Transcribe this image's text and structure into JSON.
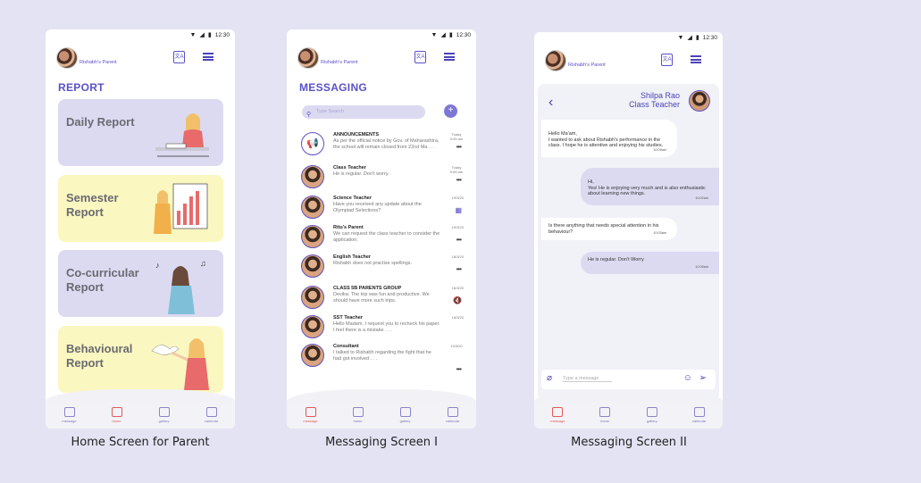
{
  "screens": {
    "home": {
      "caption": "Home Screen for Parent",
      "status": "12:30",
      "parent_label": "Rishabh's Parent",
      "title": "REPORT",
      "cards": [
        {
          "label": "Daily Report",
          "color": "#dcdaf1"
        },
        {
          "label": "Semester Report",
          "color": "#fbf7c0"
        },
        {
          "label": "Co-curricular Report",
          "color": "#dcdaf1"
        },
        {
          "label": "Behavioural Report",
          "color": "#fbf7c0"
        }
      ]
    },
    "messaging1": {
      "caption": "Messaging Screen I",
      "status": "12:30",
      "parent_label": "Rishabh's Parent",
      "title": "MESSAGING",
      "search_placeholder": "Type Search",
      "add_label": "+",
      "messages": [
        {
          "title": "ANNOUNCEMENTS",
          "text": "As per the official notice by Gov. of Maharashtra, the school will remain closed  from 22nd Ma . . .",
          "date": "Today 9:05 am",
          "icon": "megaphone-icon"
        },
        {
          "title": "Class Teacher",
          "text": "He is regular. Don't worry.",
          "date": "Today 9:05 am",
          "icon": "avatar"
        },
        {
          "title": "Science Teacher",
          "text": "Have you received any update about the Olympiad Selections?",
          "date": "19/3/20",
          "icon": "avatar"
        },
        {
          "title": "Ritu's Parent",
          "text": "We can request the class teacher to consider the application.",
          "date": "19/3/20",
          "icon": "avatar"
        },
        {
          "title": "English Teacher",
          "text": "Rishabh does not practise spellings.",
          "date": "18/3/20",
          "icon": "avatar"
        },
        {
          "title": "CLASS 5B PARENTS GROUP",
          "text": "Devika: The trip was fun and productive. We should have more such trips.",
          "date": "16/3/20",
          "icon": "avatar"
        },
        {
          "title": "SST Teacher",
          "text": "Hello Madam, I request you to recheck his paper. I feel there is a mistake . . .",
          "date": "15/3/20",
          "icon": "avatar"
        },
        {
          "title": "Consultant",
          "text": "I talked to Rishabh regarding the fight that he had got involved . . .",
          "date": "13/3/20",
          "icon": "avatar"
        }
      ]
    },
    "messaging2": {
      "caption": "Messaging Screen II",
      "status": "12:30",
      "parent_label": "Rishabh's Parent",
      "contact_name": "Shilpa Rao",
      "contact_role": "Class Teacher",
      "composer_placeholder": "Type a message",
      "chat": [
        {
          "dir": "in",
          "text": "Hello Ma'am,\nI wanted to ask about Rishabh's performance in the class. I hope he is attentive and enjoying his studies.",
          "time": "10:09am"
        },
        {
          "dir": "out",
          "text": "Hi,\nYes! He is enjoying very much and is also enthusiastic about learning new things.",
          "time": "10:02am"
        },
        {
          "dir": "in",
          "text": "Is there anything that needs special attention in his behaviour?",
          "time": "10:03am"
        },
        {
          "dir": "out",
          "text": "He is regular. Don't Worry",
          "time": "10:05am"
        }
      ]
    }
  },
  "nav": [
    "message",
    "home",
    "gallery",
    "calendar"
  ],
  "colors": {
    "accent": "#5a51c6",
    "lavender": "#dcdaf1",
    "yellow": "#fbf7c0",
    "active": "#e05a5a",
    "background": "#e3e3f4"
  }
}
